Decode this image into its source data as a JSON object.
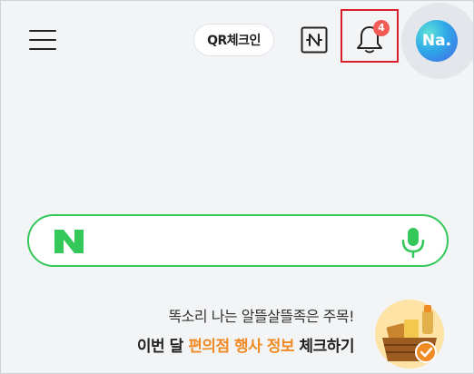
{
  "header": {
    "qr_checkin_label": "QR체크인",
    "notification_count": "4",
    "avatar_text": "Na.",
    "avatar_gradient": [
      "#5ee0d8",
      "#2fa8e8",
      "#4567e6"
    ]
  },
  "search": {
    "placeholder": "",
    "brand_letter": "N",
    "brand_color": "#34c759"
  },
  "promo": {
    "subtitle": "똑소리 나는 알뜰살뜰족은 주목!",
    "title_prefix": "이번 달 ",
    "title_highlight": "편의점 행사 정보",
    "title_suffix": " 체크하기",
    "highlight_color": "#f08a24"
  },
  "colors": {
    "background": "#f2f4f6",
    "badge": "#f25c54",
    "highlight_border": "#d8202d"
  },
  "icons": [
    "menu-icon",
    "naver-n-icon",
    "bell-icon",
    "mic-icon",
    "check-icon"
  ]
}
